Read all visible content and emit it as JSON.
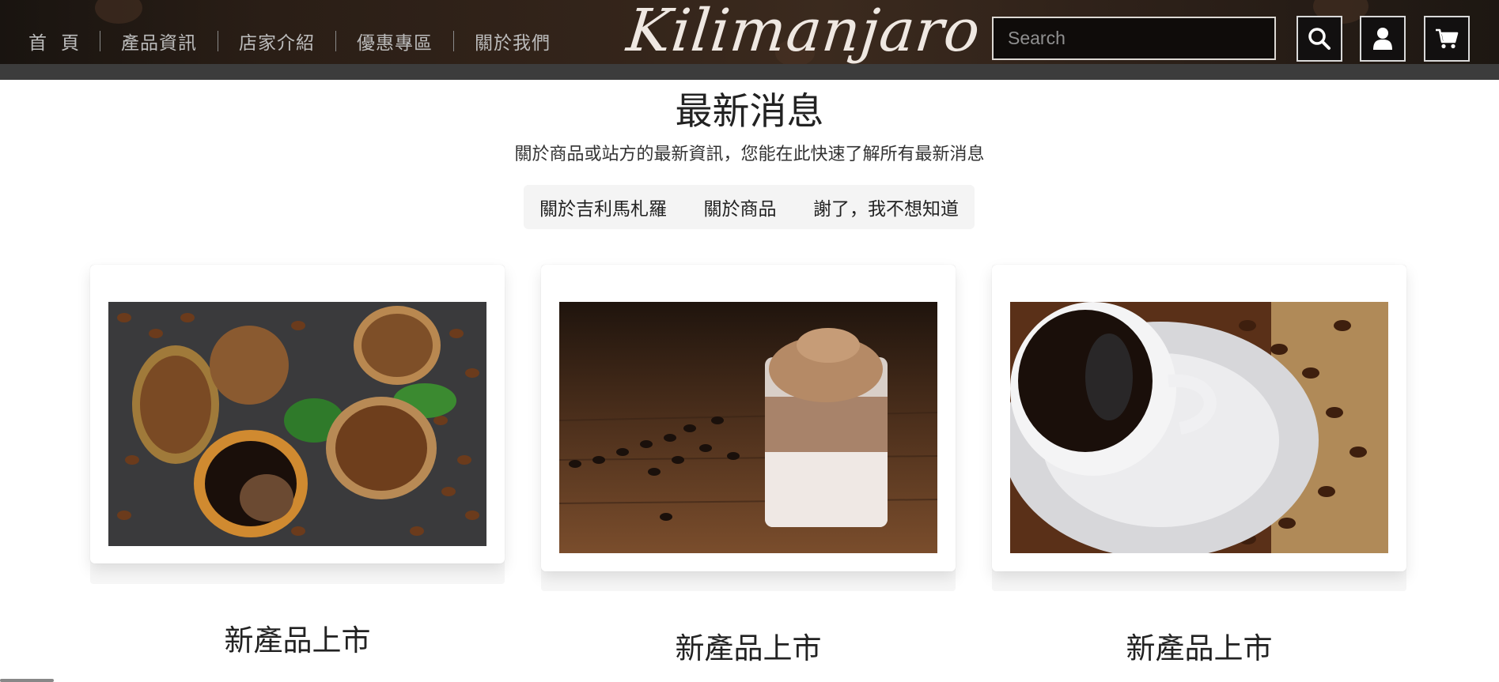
{
  "header": {
    "nav": [
      "首頁",
      "產品資訊",
      "店家介紹",
      "優惠專區",
      "關於我們"
    ],
    "logo_text": "Kilimanjaro",
    "search_placeholder": "Search",
    "icons": [
      "search-icon",
      "user-icon",
      "cart-icon"
    ]
  },
  "main": {
    "title": "最新消息",
    "subtitle": "關於商品或站方的最新資訊，您能在此快速了解所有最新消息",
    "tabs": [
      "關於吉利馬札羅",
      "關於商品",
      "謝了，我不想知道"
    ],
    "cards": [
      {
        "title": "新產品上市",
        "image": "coffee beans, ground coffee and espresso cup"
      },
      {
        "title": "新產品上市",
        "image": "dalgona whipped coffee glass on wooden table"
      },
      {
        "title": "新產品上市",
        "image": "black coffee cup on saucer with coffee beans"
      }
    ]
  },
  "colors": {
    "header_bg": "#2a1e16",
    "strip": "#3c3c3c",
    "tabs_bg": "#f4f4f4",
    "text": "#222222"
  }
}
